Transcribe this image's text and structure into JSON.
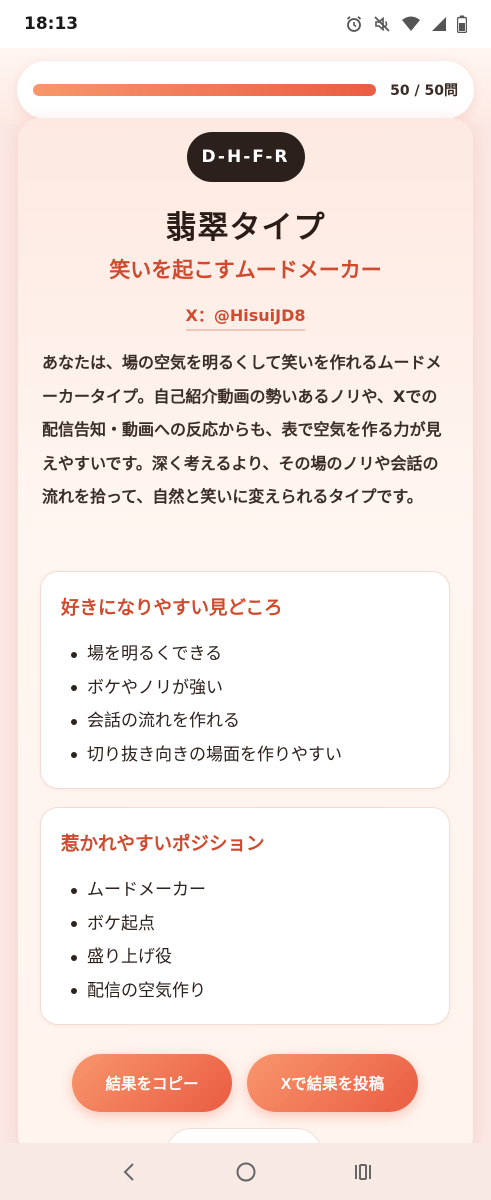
{
  "status_bar": {
    "time": "18:13",
    "icons": [
      "alarm-icon",
      "mute-icon",
      "wifi-icon",
      "signal-icon",
      "battery-icon"
    ]
  },
  "progress": {
    "fraction": 1.0,
    "count_label": "50 / 50問"
  },
  "result": {
    "type_code": "D-H-F-R",
    "type_name": "翡翠タイプ",
    "tagline": "笑いを起こすムードメーカー",
    "x_handle": "X：@HisuiJD8",
    "description": "あなたは、場の空気を明るくして笑いを作れるムードメーカータイプ。自己紹介動画の勢いあるノリや、Xでの配信告知・動画への反応からも、表で空気を作る力が見えやすいです。深く考えるより、その場のノリや会話の流れを拾って、自然と笑いに変えられるタイプです。",
    "sections": [
      {
        "title": "好きになりやすい見どころ",
        "items": [
          "場を明るくできる",
          "ボケやノリが強い",
          "会話の流れを作れる",
          "切り抜き向きの場面を作りやすい"
        ]
      },
      {
        "title": "惹かれやすいポジション",
        "items": [
          "ムードメーカー",
          "ボケ起点",
          "盛り上げ役",
          "配信の空気作り"
        ]
      }
    ]
  },
  "buttons": {
    "copy_label": "結果をコピー",
    "post_label": "Xで結果を投稿"
  },
  "nav_bar": {
    "icons": [
      "back-icon",
      "home-icon",
      "recents-icon"
    ]
  },
  "colors": {
    "accent": "#d04a2e",
    "gradient_start": "#f8966c",
    "gradient_end": "#ea5c42",
    "dark_pill": "#2b201c"
  }
}
